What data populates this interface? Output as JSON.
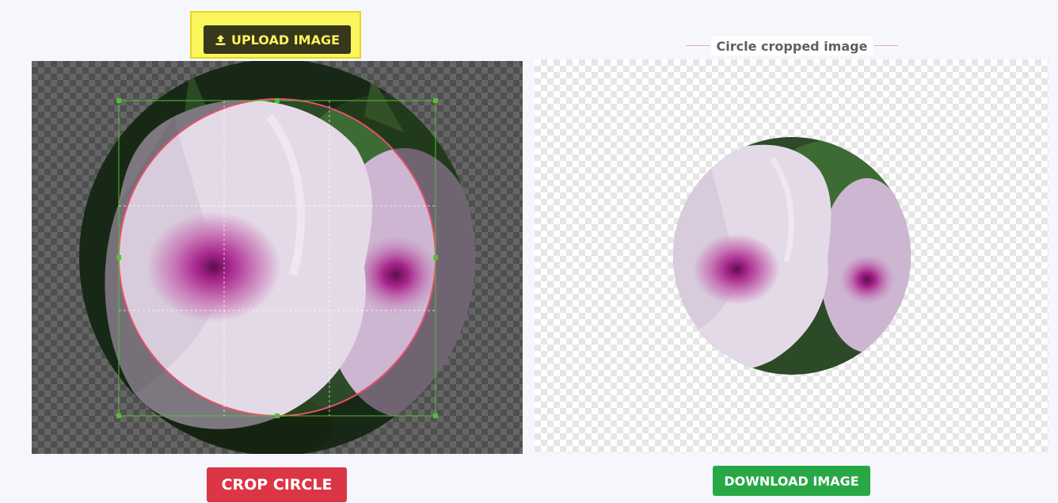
{
  "upload": {
    "label": "UPLOAD IMAGE",
    "icon": "upload-icon"
  },
  "cropper": {
    "source_image": "flower-photo"
  },
  "actions": {
    "crop_label": "CROP CIRCLE",
    "download_label": "DOWNLOAD IMAGE"
  },
  "result": {
    "title": "Circle cropped image",
    "image": "flower-photo-circle"
  },
  "colors": {
    "upload_bg": "#fbf55d",
    "upload_button": "#37371c",
    "crop_button": "#dc3545",
    "download_button": "#28a745",
    "crop_circle": "#e8506a",
    "crop_box": "#54c034"
  }
}
